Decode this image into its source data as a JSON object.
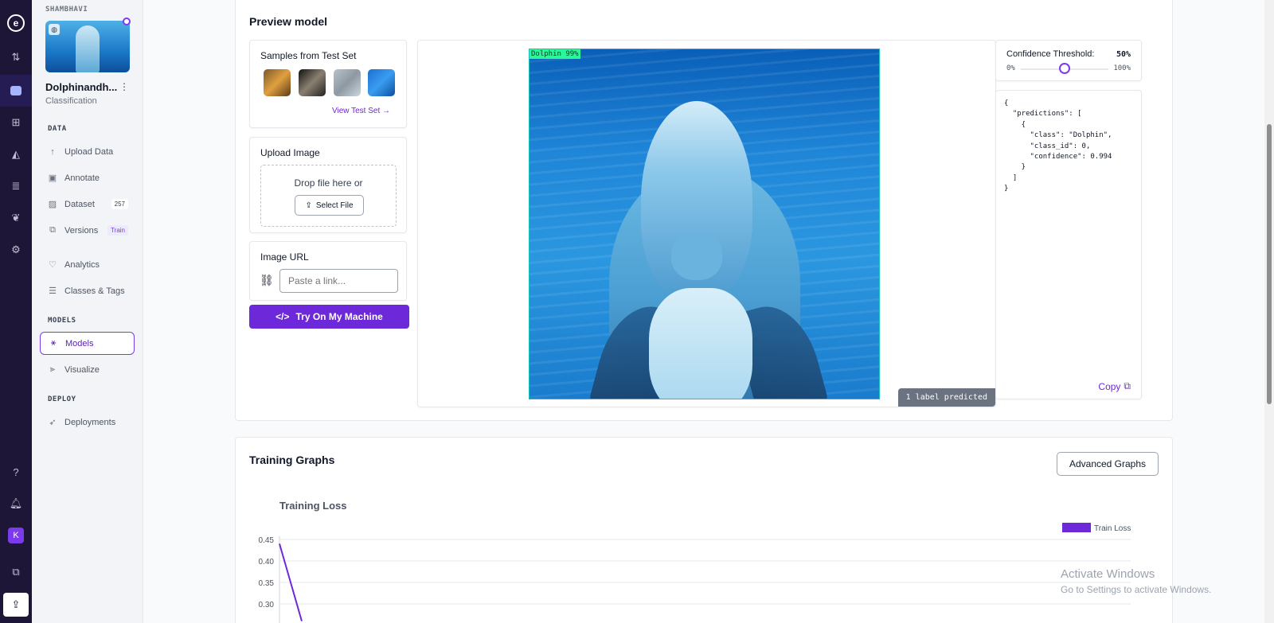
{
  "rail": {
    "items": [
      "logo",
      "swap-icon",
      "inbox-icon",
      "diagram-icon",
      "chart-icon",
      "layers-icon",
      "leaf-icon",
      "gear-icon"
    ],
    "avatar": "K"
  },
  "sidebar": {
    "workspace": "SHAMBHAVI",
    "project_name": "Dolphinandh...",
    "project_type": "Classification",
    "sections": {
      "data": "DATA",
      "models": "MODELS",
      "deploy": "DEPLOY"
    },
    "items": {
      "upload": "Upload Data",
      "annotate": "Annotate",
      "dataset": "Dataset",
      "dataset_count": "257",
      "versions": "Versions",
      "versions_badge": "Train",
      "analytics": "Analytics",
      "classes": "Classes & Tags",
      "models": "Models",
      "visualize": "Visualize",
      "deployments": "Deployments"
    }
  },
  "preview": {
    "title": "Preview model",
    "samples_title": "Samples from Test Set",
    "view_test_set": "View Test Set →",
    "upload_title": "Upload Image",
    "drop_text": "Drop file here or",
    "select_file": "Select File",
    "url_title": "Image URL",
    "url_placeholder": "Paste a link...",
    "try_button": "Try On My Machine",
    "detection_label": "Dolphin 99%",
    "labels_predicted": "1 label predicted",
    "threshold": {
      "title": "Confidence Threshold:",
      "value": "50%",
      "value_fraction": 0.5,
      "min": "0%",
      "max": "100%"
    },
    "json_output": "{\n  \"predictions\": [\n    {\n      \"class\": \"Dolphin\",\n      \"class_id\": 0,\n      \"confidence\": 0.994\n    }\n  ]\n}",
    "copy": "Copy"
  },
  "graphs": {
    "title": "Training Graphs",
    "advanced_button": "Advanced Graphs",
    "chart_title": "Training Loss"
  },
  "chart_data": {
    "type": "line",
    "title": "Training Loss",
    "legend": "Train Loss",
    "legend_position": "top-right",
    "yticks": [
      "0.45",
      "0.40",
      "0.35",
      "0.30"
    ],
    "visible_ylim": [
      0.3,
      0.45
    ],
    "series": [
      {
        "name": "Train Loss",
        "color": "#6d28d9",
        "points": [
          [
            0,
            0.44
          ],
          [
            1,
            0.26
          ]
        ]
      }
    ]
  },
  "watermark": {
    "line1": "Activate Windows",
    "line2": "Go to Settings to activate Windows."
  },
  "colors": {
    "accent": "#6d28d9",
    "rail_bg": "#1e1636",
    "detection_box": "#16c2c2",
    "detection_label_bg": "#2cf59a"
  }
}
